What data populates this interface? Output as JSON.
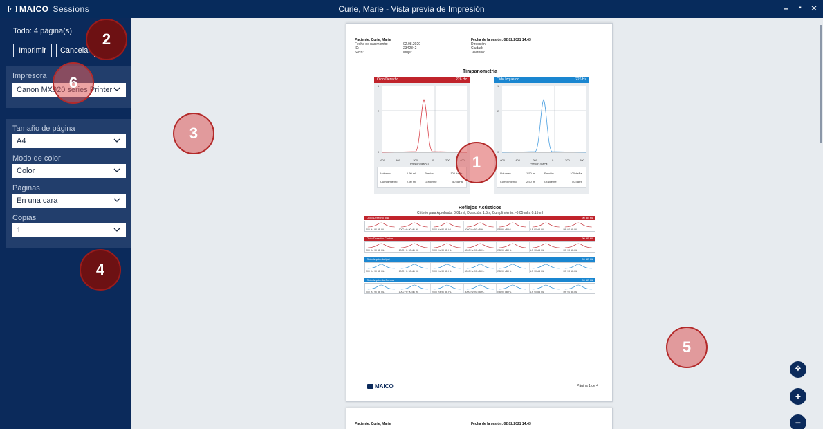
{
  "window": {
    "logo_text": "MAICO",
    "app_name": "Sessions",
    "title": "Curie, Marie - Vista previa de Impresión",
    "controls": {
      "minimize": "–",
      "maximize": "▪",
      "close": "✕"
    }
  },
  "sidebar": {
    "total_pages": "Todo: 4 página(s)",
    "print_label": "Imprimir",
    "cancel_label": "Cancelar",
    "printer_label": "Impresora",
    "printer_value": "Canon MX920 series Printer",
    "page_size_label": "Tamaño de página",
    "page_size_value": "A4",
    "color_mode_label": "Modo de color",
    "color_mode_value": "Color",
    "pages_label": "Páginas",
    "pages_value": "En una cara",
    "copies_label": "Copias",
    "copies_value": "1"
  },
  "page1": {
    "patient_label": "Paciente: Curie, Marie",
    "dob_label": "Fecha de nacimiento:",
    "dob_value": "02.08.2020",
    "id_label": "ID:",
    "id_value": "2342342",
    "sex_label": "Sexo:",
    "sex_value": "Mujer",
    "session_date": "Fecha de la sesión: 02.02.2021 14:43",
    "address_label": "Dirección:",
    "city_label": "Ciudad:",
    "phone_label": "Teléfono:",
    "tymp_title": "Timpanometría",
    "right_ear": "Oído Derecho",
    "left_ear": "Oído Izquierdo",
    "hz": "226 Hz",
    "xaxis_label": "Presión (daPa)",
    "yaxis_label": "Cumplimiento (ml)",
    "x_ticks": [
      "-600",
      "-400",
      "-200",
      "0",
      "200",
      "400"
    ],
    "volumen_label": "Volumen",
    "volumen_value": "1.50 ml",
    "presion_label": "Presión",
    "presion_value": "-100 daPa",
    "cumplimiento_label": "Cumplimiento",
    "cumplimiento_value": "2.50 ml",
    "gradiente_label": "Gradiente",
    "gradiente_value": "50 daPa",
    "reflex_title": "Reflejos Acústicos",
    "reflex_criteria": "Criterio para Aprobado: 0.01 ml; Duración: 1.5 s; Cumplimiento: -0.05 ml a 0.15 ml",
    "reflex_rows": [
      {
        "name": "Oído Derecho Ipsi",
        "level": "90 dB HL",
        "color": "#c0232b"
      },
      {
        "name": "Oído Derecho Contra",
        "level": "90 dB HL",
        "color": "#c0232b"
      },
      {
        "name": "Oído Izquierdo Ipsi",
        "level": "90 dB HL",
        "color": "#1a86d0"
      },
      {
        "name": "Oído Izquierdo Contra",
        "level": "90 dB HL",
        "color": "#1a86d0"
      }
    ],
    "reflex_freqs": [
      "500 Hz",
      "1000 Hz",
      "2000 Hz",
      "4000 Hz",
      "BB",
      "LP",
      "HP"
    ],
    "reflex_cell_level": "90 dB HL",
    "footer_logo": "MAICO",
    "page_number": "Página 1 de 4"
  },
  "page2": {
    "patient_label": "Paciente: Curie, Marie",
    "session_date": "Fecha de la sesión: 02.02.2021 14:43"
  },
  "zoom": {
    "fit": "✥",
    "in": "+",
    "out": "−"
  },
  "callouts": [
    "1",
    "2",
    "3",
    "4",
    "5",
    "6"
  ],
  "colors": {
    "navy": "#0b2a5b",
    "right_ear": "#c0232b",
    "left_ear": "#1a86d0",
    "preview_bg": "#e7ebef"
  }
}
